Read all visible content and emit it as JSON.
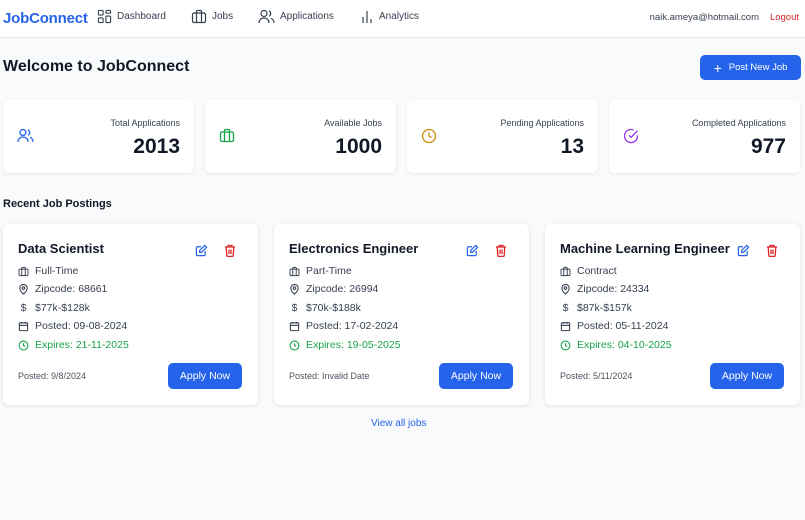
{
  "nav": {
    "brand": "JobConnect",
    "items": [
      {
        "label": "Dashboard",
        "icon": "dashboard-grid-icon"
      },
      {
        "label": "Jobs",
        "icon": "briefcase-icon"
      },
      {
        "label": "Applications",
        "icon": "users-icon"
      },
      {
        "label": "Analytics",
        "icon": "bar-chart-icon"
      }
    ],
    "email": "naik.ameya@hotmail.com",
    "logout": "Logout"
  },
  "page": {
    "title": "Welcome to JobConnect",
    "post_button": "Post New Job"
  },
  "stats": [
    {
      "label": "Total Applications",
      "value": "2013",
      "icon": "users-icon",
      "color": "#2563eb"
    },
    {
      "label": "Available Jobs",
      "value": "1000",
      "icon": "briefcase-icon",
      "color": "#16a34a"
    },
    {
      "label": "Pending Applications",
      "value": "13",
      "icon": "clock-icon",
      "color": "#ca8a04"
    },
    {
      "label": "Completed Applications",
      "value": "977",
      "icon": "check-circle-icon",
      "color": "#9333ea"
    }
  ],
  "section_title": "Recent Job Postings",
  "jobs": [
    {
      "title": "Data Scientist",
      "type": "Full-Time",
      "zipcode": "Zipcode: 68661",
      "salary": "$77k-$128k",
      "posted": "Posted: 09-08-2024",
      "expires": "Expires: 21-11-2025",
      "footer": "Posted: 9/8/2024",
      "apply": "Apply Now"
    },
    {
      "title": "Electronics Engineer",
      "type": "Part-Time",
      "zipcode": "Zipcode: 26994",
      "salary": "$70k-$188k",
      "posted": "Posted: 17-02-2024",
      "expires": "Expires: 19-05-2025",
      "footer": "Posted: Invalid Date",
      "apply": "Apply Now"
    },
    {
      "title": "Machine Learning Engineer",
      "type": "Contract",
      "zipcode": "Zipcode: 24334",
      "salary": "$87k-$157k",
      "posted": "Posted: 05-11-2024",
      "expires": "Expires: 04-10-2025",
      "footer": "Posted: 5/11/2024",
      "apply": "Apply Now"
    }
  ],
  "view_all": "View all jobs"
}
